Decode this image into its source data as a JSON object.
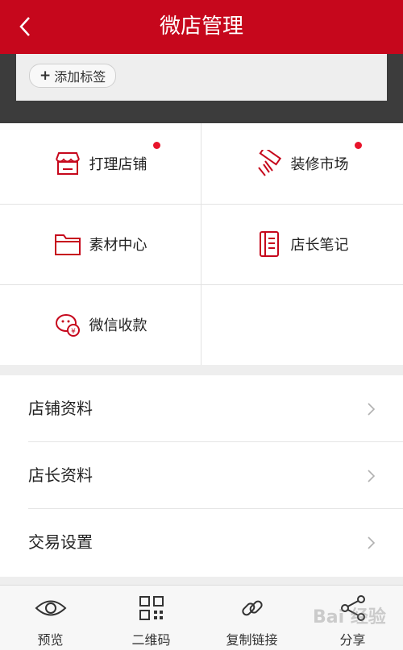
{
  "header": {
    "title": "微店管理",
    "back_icon": "chevron-left-icon"
  },
  "tag_panel": {
    "add_tag_label": "添加标签",
    "plus": "+"
  },
  "grid": {
    "items": [
      {
        "label": "打理店铺",
        "icon": "shop-icon",
        "badge": true
      },
      {
        "label": "装修市场",
        "icon": "paint-roller-icon",
        "badge": true
      },
      {
        "label": "素材中心",
        "icon": "folder-icon",
        "badge": false
      },
      {
        "label": "店长笔记",
        "icon": "notebook-icon",
        "badge": false
      },
      {
        "label": "微信收款",
        "icon": "wechat-pay-icon",
        "badge": false
      }
    ]
  },
  "list": {
    "items": [
      {
        "label": "店铺资料"
      },
      {
        "label": "店长资料"
      },
      {
        "label": "交易设置"
      }
    ]
  },
  "bottom_bar": {
    "tabs": [
      {
        "label": "预览",
        "icon": "eye-icon"
      },
      {
        "label": "二维码",
        "icon": "qrcode-icon"
      },
      {
        "label": "复制链接",
        "icon": "link-icon"
      },
      {
        "label": "分享",
        "icon": "share-icon"
      }
    ]
  },
  "colors": {
    "brand_red": "#c6071c",
    "badge_red": "#e8142b",
    "icon_red": "#c6071c"
  },
  "watermark": "Bai 经验"
}
